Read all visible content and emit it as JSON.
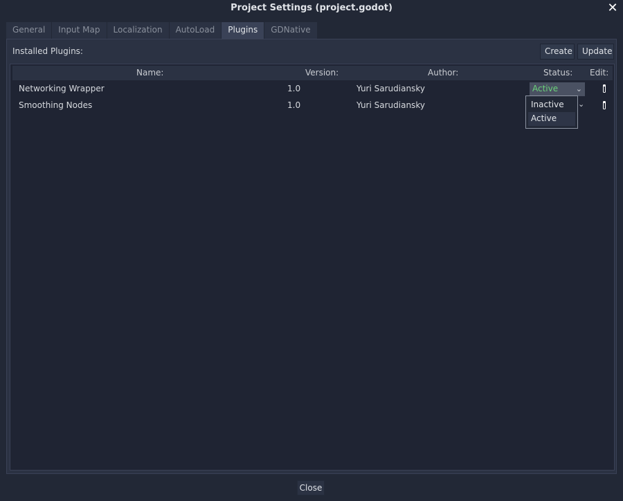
{
  "window": {
    "title": "Project Settings (project.godot)",
    "close_glyph": "✕"
  },
  "tabs": [
    {
      "label": "General"
    },
    {
      "label": "Input Map"
    },
    {
      "label": "Localization"
    },
    {
      "label": "AutoLoad"
    },
    {
      "label": "Plugins"
    },
    {
      "label": "GDNative"
    }
  ],
  "active_tab": "Plugins",
  "plugins_panel": {
    "installed_label": "Installed Plugins:",
    "create_label": "Create",
    "update_label": "Update",
    "columns": {
      "name": "Name:",
      "version": "Version:",
      "author": "Author:",
      "status": "Status:",
      "edit": "Edit:"
    },
    "rows": [
      {
        "name": "Networking Wrapper",
        "version": "1.0",
        "author": "Yuri Sarudiansky",
        "status": "Active"
      },
      {
        "name": "Smoothing Nodes",
        "version": "1.0",
        "author": "Yuri Sarudiansky",
        "status": "Active"
      }
    ],
    "status_popup": {
      "options": [
        "Inactive",
        "Active"
      ],
      "highlighted": "Active"
    }
  },
  "footer": {
    "close_label": "Close"
  },
  "colors": {
    "background": "#222836",
    "panel": "#2b3243",
    "active_status": "#6ad27a"
  }
}
